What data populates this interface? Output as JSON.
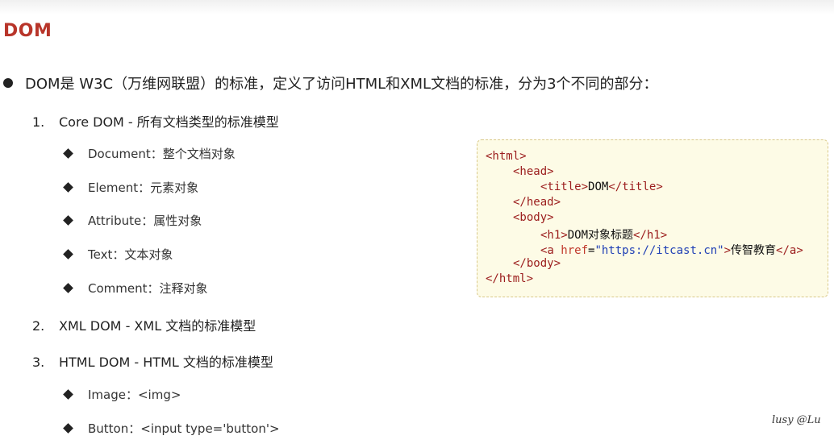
{
  "title": "DOM",
  "intro": "DOM是 W3C（万维网联盟）的标准，定义了访问HTML和XML文档的标准，分为3个不同的部分：",
  "parts": [
    {
      "num": "1.",
      "text": "Core DOM - 所有文档类型的标准模型"
    },
    {
      "num": "2.",
      "text": "XML DOM - XML 文档的标准模型"
    },
    {
      "num": "3.",
      "text": "HTML DOM - HTML 文档的标准模型"
    }
  ],
  "core_items": [
    "Document：整个文档对象",
    "Element：元素对象",
    "Attribute：属性对象",
    "Text：文本对象",
    "Comment：注释对象"
  ],
  "html_items": [
    "Image：<img>",
    "Button：<input type='button'>"
  ],
  "code": {
    "l1": "<html>",
    "l2": "<head>",
    "l3_open": "<title>",
    "l3_text": "DOM",
    "l3_close": "</title>",
    "l4": "</head>",
    "l5": "<body>",
    "l6_open": "<h1>",
    "l6_text": "DOM对象标题",
    "l6_close": "</h1>",
    "l7_open": "<a ",
    "l7_attr": "href",
    "l7_eq": "=",
    "l7_val": "\"https://itcast.cn\"",
    "l7_gt": ">",
    "l7_text": "传智教育",
    "l7_close": "</a>",
    "l8": "</body>",
    "l9": "</html>"
  },
  "signature": "lusy @Lu"
}
